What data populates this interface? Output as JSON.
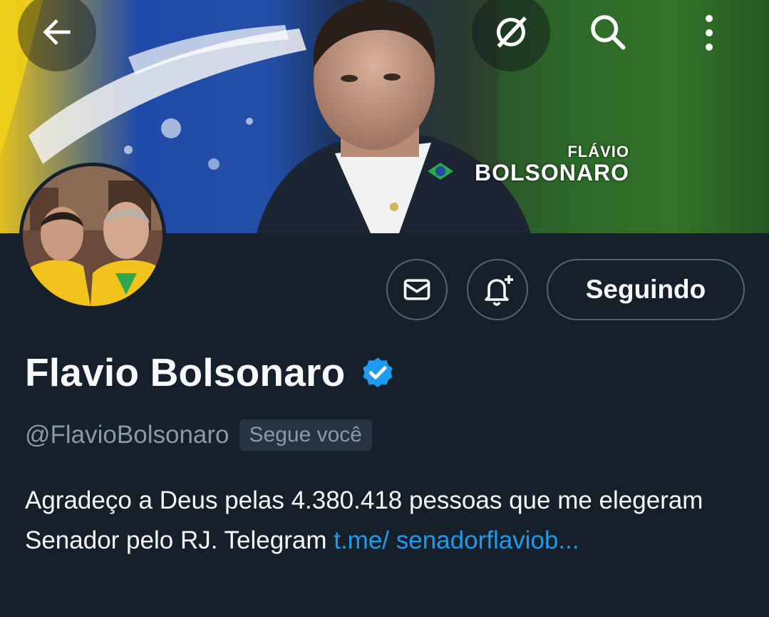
{
  "banner": {
    "name_first": "FLÁVIO",
    "name_last": "BOLSONARO"
  },
  "topbar": {
    "back_icon": "arrow-left-icon",
    "grok_icon": "slash-circle-icon",
    "search_icon": "search-icon",
    "more_icon": "more-vertical-icon"
  },
  "actions": {
    "message_icon": "mail-icon",
    "notify_icon": "bell-plus-icon",
    "follow_label": "Seguindo"
  },
  "profile": {
    "display_name": "Flavio Bolsonaro",
    "handle": "@FlavioBolsonaro",
    "follows_you": "Segue você",
    "bio_text": "Agradeço a Deus pelas 4.380.418 pessoas que me elegeram Senador pelo RJ. Telegram ",
    "bio_link": "t.me/ senadorflaviob..."
  },
  "colors": {
    "background": "#15202b",
    "accent": "#1d9bf0",
    "muted": "#8b98a5",
    "border": "#536471"
  }
}
